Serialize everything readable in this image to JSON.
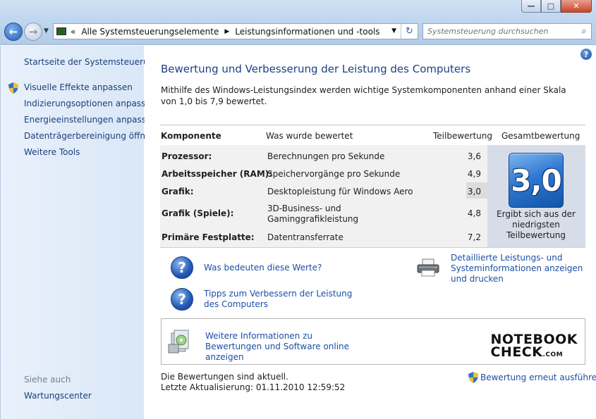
{
  "window": {
    "buttons": {
      "minimize": "—",
      "maximize": "□",
      "close": "✕"
    }
  },
  "address_bar": {
    "prefix": "«",
    "crumbs": [
      "Alle Systemsteuerungselemente",
      "Leistungsinformationen und -tools"
    ]
  },
  "search": {
    "placeholder": "Systemsteuerung durchsuchen"
  },
  "sidebar": {
    "home": "Startseite der Systemsteuerung",
    "items": [
      "Visuelle Effekte anpassen",
      "Indizierungsoptionen anpassen",
      "Energieeinstellungen anpassen",
      "Datenträgerbereinigung öffnen",
      "Weitere Tools"
    ],
    "see_also_title": "Siehe auch",
    "see_also_items": [
      "Wartungscenter"
    ]
  },
  "main": {
    "title": "Bewertung und Verbesserung der Leistung des Computers",
    "intro": "Mithilfe des Windows-Leistungsindex werden wichtige Systemkomponenten anhand einer Skala von 1,0 bis 7,9 bewertet.",
    "table": {
      "headers": [
        "Komponente",
        "Was wurde bewertet",
        "Teilbewertung",
        "Gesamtbewertung"
      ],
      "rows": [
        {
          "component": "Prozessor:",
          "rated": "Berechnungen pro Sekunde",
          "score": "3,6"
        },
        {
          "component": "Arbeitsspeicher (RAM):",
          "rated": "Speichervorgänge pro Sekunde",
          "score": "4,9"
        },
        {
          "component": "Grafik:",
          "rated": "Desktopleistung für Windows Aero",
          "score": "3,0"
        },
        {
          "component": "Grafik (Spiele):",
          "rated": "3D-Business- und Gaminggrafikleistung",
          "score": "4,8"
        },
        {
          "component": "Primäre Festplatte:",
          "rated": "Datentransferrate",
          "score": "7,2"
        }
      ],
      "base_score": "3,0",
      "base_caption": "Ergibt sich aus der niedrigsten Teilbewertung"
    },
    "links": {
      "what_mean": "Was bedeuten diese Werte?",
      "tips": "Tipps zum Verbessern der Leistung des Computers",
      "details": "Detaillierte Leistungs- und Systeminformationen anzeigen und drucken",
      "more_info": "Weitere Informationen zu Bewertungen und Software online anzeigen"
    },
    "logo": {
      "line1": "NOTEBOOK",
      "line2": "CHECK",
      "suffix": ".COM"
    },
    "status": {
      "current": "Die Bewertungen sind aktuell.",
      "last_update": "Letzte Aktualisierung: 01.11.2010 12:59:52"
    },
    "rerun": "Bewertung erneut ausführen"
  },
  "colors": {
    "link": "#1c4fa6",
    "title": "#1f3f84",
    "sidebar_link": "#1c3f7a",
    "score_tile": "#2f78d0"
  },
  "icons": {
    "help": "?",
    "back": "←",
    "forward": "→",
    "search": "⌕",
    "refresh": "↻"
  }
}
